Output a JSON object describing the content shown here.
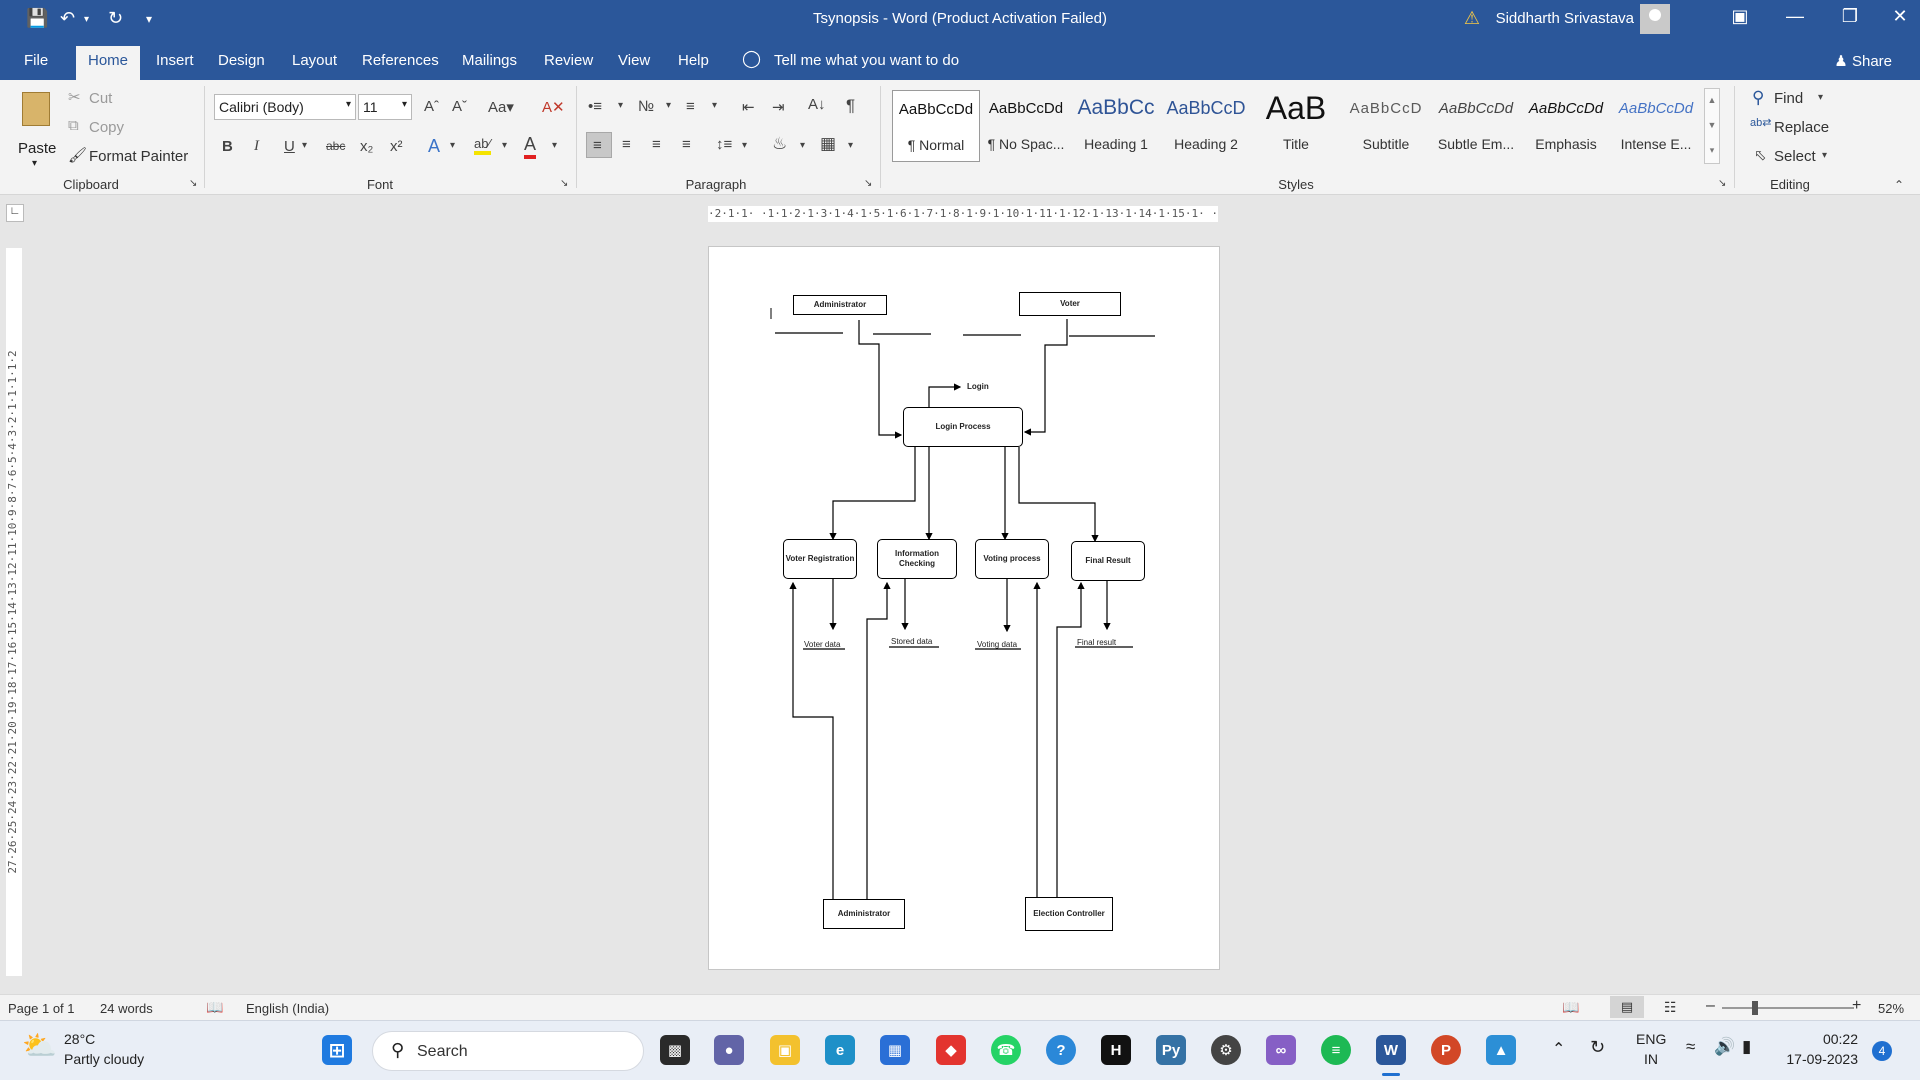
{
  "titlebar": {
    "doc_title": "Tsynopsis  -  Word (Product Activation Failed)",
    "user_name": "Siddharth Srivastava"
  },
  "tabs": [
    "File",
    "Home",
    "Insert",
    "Design",
    "Layout",
    "References",
    "Mailings",
    "Review",
    "View",
    "Help"
  ],
  "tell_me": "Tell me what you want to do",
  "share_label": "Share",
  "ribbon": {
    "clipboard": {
      "paste": "Paste",
      "cut": "Cut",
      "copy": "Copy",
      "format_painter": "Format Painter",
      "label": "Clipboard"
    },
    "font": {
      "family": "Calibri (Body)",
      "size": "11",
      "label": "Font"
    },
    "paragraph": {
      "label": "Paragraph"
    },
    "styles": {
      "label": "Styles",
      "items": [
        {
          "sample": "AaBbCcDd",
          "name": "¶ Normal"
        },
        {
          "sample": "AaBbCcDd",
          "name": "¶ No Spac..."
        },
        {
          "sample": "AaBbCc",
          "name": "Heading 1"
        },
        {
          "sample": "AaBbCcD",
          "name": "Heading 2"
        },
        {
          "sample": "AaB",
          "name": "Title"
        },
        {
          "sample": "AaBbCcD",
          "name": "Subtitle"
        },
        {
          "sample": "AaBbCcDd",
          "name": "Subtle Em..."
        },
        {
          "sample": "AaBbCcDd",
          "name": "Emphasis"
        },
        {
          "sample": "AaBbCcDd",
          "name": "Intense E..."
        }
      ]
    },
    "editing": {
      "find": "Find",
      "replace": "Replace",
      "select": "Select",
      "label": "Editing"
    }
  },
  "rulers": {
    "horizontal": "·2·1·1· ·1·1·2·1·3·1·4·1·5·1·6·1·7·1·8·1·9·1·10·1·11·1·12·1·13·1·14·1·15·1· ·17·1·18",
    "vertical": "27·26·25·24·23·22·21·20·19·18·17·16·15·14·13·12·11·10·9·8·7·6·5·4·3·2·1·1·1·1·2"
  },
  "diagram": {
    "admin_top": "Administrator",
    "voter_top": "Voter",
    "login": "Login",
    "login_process": "Login Process",
    "voter_registration": "Voter Registration",
    "information_checking": "Information Checking",
    "voting_process": "Voting process",
    "final_result_box": "Final Result",
    "voter_data": "Voter data",
    "stored_data": "Stored data",
    "voting_data": "Voting data",
    "final_result_store": "Final result",
    "election_controller": "Election Controller",
    "admin_bottom": "Administrator"
  },
  "statusbar": {
    "page": "Page 1 of 1",
    "words": "24 words",
    "language": "English (India)",
    "zoom": "52%"
  },
  "taskbar": {
    "weather_temp": "28°C",
    "weather_desc": "Partly cloudy",
    "search": "Search",
    "lang_line1": "ENG",
    "lang_line2": "IN",
    "time": "00:22",
    "date": "17-09-2023",
    "notifications": "4"
  },
  "colors": {
    "word_blue": "#2b579a",
    "page_bg": "#ffffff",
    "canvas_bg": "#e6e6e6"
  }
}
